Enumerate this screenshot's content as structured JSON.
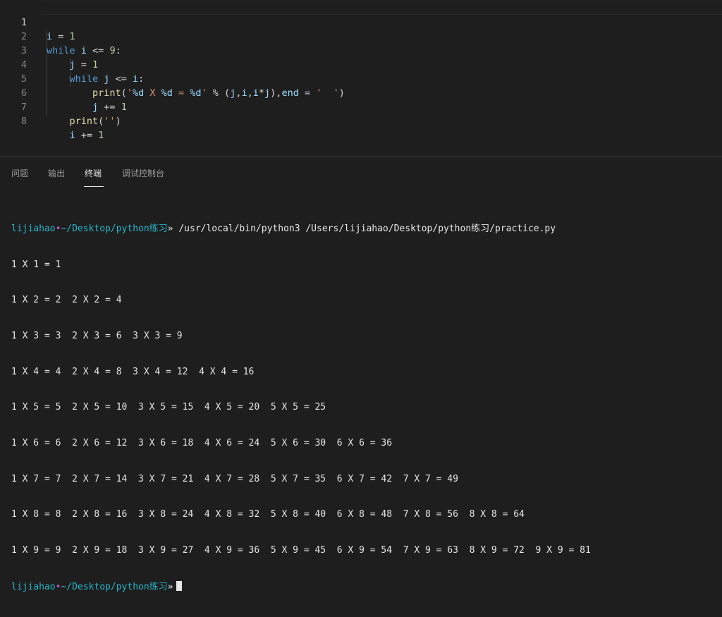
{
  "editor": {
    "line_numbers": [
      "1",
      "2",
      "3",
      "4",
      "5",
      "6",
      "7",
      "8"
    ],
    "lines": [
      [
        {
          "t": "i",
          "c": "var"
        },
        {
          "t": " = ",
          "c": "op"
        },
        {
          "t": "1",
          "c": "num"
        }
      ],
      [
        {
          "t": "while",
          "c": "kw"
        },
        {
          "t": " ",
          "c": "op"
        },
        {
          "t": "i",
          "c": "var"
        },
        {
          "t": " <= ",
          "c": "op"
        },
        {
          "t": "9",
          "c": "num"
        },
        {
          "t": ":",
          "c": "op"
        }
      ],
      [
        {
          "t": "    ",
          "c": "op"
        },
        {
          "t": "j",
          "c": "var"
        },
        {
          "t": " = ",
          "c": "op"
        },
        {
          "t": "1",
          "c": "num"
        }
      ],
      [
        {
          "t": "    ",
          "c": "op"
        },
        {
          "t": "while",
          "c": "kw"
        },
        {
          "t": " ",
          "c": "op"
        },
        {
          "t": "j",
          "c": "var"
        },
        {
          "t": " <= ",
          "c": "op"
        },
        {
          "t": "i",
          "c": "var"
        },
        {
          "t": ":",
          "c": "op"
        }
      ],
      [
        {
          "t": "        ",
          "c": "op"
        },
        {
          "t": "print",
          "c": "fn"
        },
        {
          "t": "(",
          "c": "op"
        },
        {
          "t": "'",
          "c": "str"
        },
        {
          "t": "%d",
          "c": "var"
        },
        {
          "t": " X ",
          "c": "str"
        },
        {
          "t": "%d",
          "c": "var"
        },
        {
          "t": " = ",
          "c": "str"
        },
        {
          "t": "%d",
          "c": "var"
        },
        {
          "t": "'",
          "c": "str"
        },
        {
          "t": " % (",
          "c": "op"
        },
        {
          "t": "j",
          "c": "var"
        },
        {
          "t": ",",
          "c": "op"
        },
        {
          "t": "i",
          "c": "var"
        },
        {
          "t": ",",
          "c": "op"
        },
        {
          "t": "i",
          "c": "var"
        },
        {
          "t": "*",
          "c": "op"
        },
        {
          "t": "j",
          "c": "var"
        },
        {
          "t": "),",
          "c": "op"
        },
        {
          "t": "end",
          "c": "var"
        },
        {
          "t": " = ",
          "c": "op"
        },
        {
          "t": "'  '",
          "c": "str"
        },
        {
          "t": ")",
          "c": "op"
        }
      ],
      [
        {
          "t": "        ",
          "c": "op"
        },
        {
          "t": "j",
          "c": "var"
        },
        {
          "t": " += ",
          "c": "op"
        },
        {
          "t": "1",
          "c": "num"
        }
      ],
      [
        {
          "t": "    ",
          "c": "op"
        },
        {
          "t": "print",
          "c": "fn"
        },
        {
          "t": "(",
          "c": "op"
        },
        {
          "t": "''",
          "c": "str"
        },
        {
          "t": ")",
          "c": "op"
        }
      ],
      [
        {
          "t": "    ",
          "c": "op"
        },
        {
          "t": "i",
          "c": "var"
        },
        {
          "t": " += ",
          "c": "op"
        },
        {
          "t": "1",
          "c": "num"
        }
      ]
    ]
  },
  "panel": {
    "tabs": [
      {
        "label": "问题",
        "active": false
      },
      {
        "label": "输出",
        "active": false
      },
      {
        "label": "终端",
        "active": true
      },
      {
        "label": "调试控制台",
        "active": false
      }
    ]
  },
  "terminal": {
    "prompt_user": "lijiahao",
    "prompt_dot": "•",
    "prompt_path": "~/Desktop/python练习",
    "prompt_arrow": "»",
    "command": " /usr/local/bin/python3 /Users/lijiahao/Desktop/python练习/practice.py",
    "output": [
      "1 X 1 = 1",
      "1 X 2 = 2  2 X 2 = 4",
      "1 X 3 = 3  2 X 3 = 6  3 X 3 = 9",
      "1 X 4 = 4  2 X 4 = 8  3 X 4 = 12  4 X 4 = 16",
      "1 X 5 = 5  2 X 5 = 10  3 X 5 = 15  4 X 5 = 20  5 X 5 = 25",
      "1 X 6 = 6  2 X 6 = 12  3 X 6 = 18  4 X 6 = 24  5 X 6 = 30  6 X 6 = 36",
      "1 X 7 = 7  2 X 7 = 14  3 X 7 = 21  4 X 7 = 28  5 X 7 = 35  6 X 7 = 42  7 X 7 = 49",
      "1 X 8 = 8  2 X 8 = 16  3 X 8 = 24  4 X 8 = 32  5 X 8 = 40  6 X 8 = 48  7 X 8 = 56  8 X 8 = 64",
      "1 X 9 = 9  2 X 9 = 18  3 X 9 = 27  4 X 9 = 36  5 X 9 = 45  6 X 9 = 54  7 X 9 = 63  8 X 9 = 72  9 X 9 = 81"
    ]
  }
}
